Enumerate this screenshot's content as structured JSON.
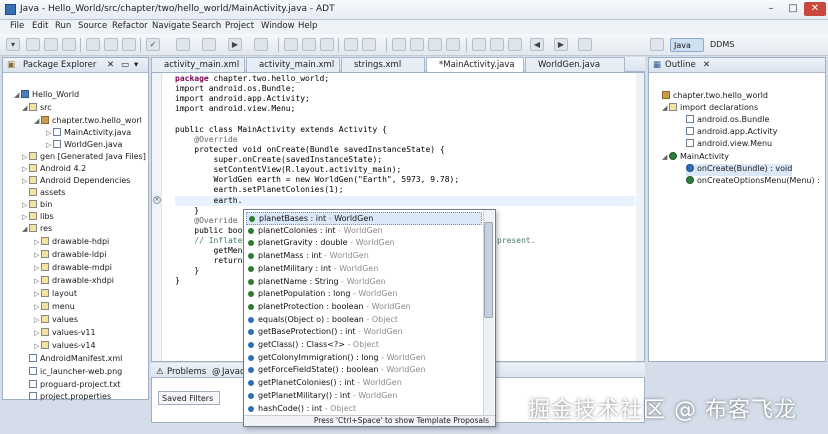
{
  "window": {
    "title": "Java - Hello_World/src/chapter/two/hello_world/MainActivity.java - ADT",
    "minimize": "–",
    "maximize": "□",
    "close": "✕"
  },
  "menu": [
    "File",
    "Edit",
    "Run",
    "Source",
    "Refactor",
    "Navigate",
    "Search",
    "Project",
    "Window",
    "Help"
  ],
  "perspectives": {
    "java": "Java",
    "ddms": "DDMS"
  },
  "package_explorer": {
    "tab": "Package Explorer",
    "items": [
      {
        "label": "Hello_World",
        "icon": "project-icon"
      },
      {
        "label": "src",
        "icon": "folder-icon"
      },
      {
        "label": "chapter.two.hello_worl",
        "icon": "package-icon"
      },
      {
        "label": "MainActivity.java",
        "icon": "java-file-icon"
      },
      {
        "label": "WorldGen.java",
        "icon": "java-file-icon"
      },
      {
        "label": "gen [Generated Java Files]",
        "icon": "folder-icon"
      },
      {
        "label": "Android 4.2",
        "icon": "library-icon"
      },
      {
        "label": "Android Dependencies",
        "icon": "library-icon"
      },
      {
        "label": "assets",
        "icon": "folder-icon"
      },
      {
        "label": "bin",
        "icon": "folder-icon"
      },
      {
        "label": "libs",
        "icon": "folder-icon"
      },
      {
        "label": "res",
        "icon": "folder-icon"
      },
      {
        "label": "drawable-hdpi",
        "icon": "folder-icon"
      },
      {
        "label": "drawable-ldpi",
        "icon": "folder-icon"
      },
      {
        "label": "drawable-mdpi",
        "icon": "folder-icon"
      },
      {
        "label": "drawable-xhdpi",
        "icon": "folder-icon"
      },
      {
        "label": "layout",
        "icon": "folder-icon"
      },
      {
        "label": "menu",
        "icon": "folder-icon"
      },
      {
        "label": "values",
        "icon": "folder-icon"
      },
      {
        "label": "values-v11",
        "icon": "folder-icon"
      },
      {
        "label": "values-v14",
        "icon": "folder-icon"
      },
      {
        "label": "AndroidManifest.xml",
        "icon": "xml-file-icon"
      },
      {
        "label": "ic_launcher-web.png",
        "icon": "image-file-icon"
      },
      {
        "label": "proguard-project.txt",
        "icon": "text-file-icon"
      },
      {
        "label": "project.properties",
        "icon": "text-file-icon"
      }
    ]
  },
  "editor": {
    "tabs": [
      "activity_main.xml",
      "activity_main.xml",
      "strings.xml",
      "*MainActivity.java",
      "WorldGen.java"
    ],
    "code": [
      "package chapter.two.hello_world;",
      "import android.os.Bundle;",
      "import android.app.Activity;",
      "import android.view.Menu;",
      "",
      "public class MainActivity extends Activity {",
      "    @Override",
      "    protected void onCreate(Bundle savedInstanceState) {",
      "        super.onCreate(savedInstanceState);",
      "        setContentView(R.layout.activity_main);",
      "        WorldGen earth = new WorldGen(\"Earth\", 5973, 9.78);",
      "        earth.setPlanetColonies(1);",
      "        earth.",
      "    }",
      "    @Override",
      "    public boo",
      "    // Inflate",
      "        getMen",
      "        return",
      "    }",
      "}"
    ],
    "tail_text": "present."
  },
  "outline": {
    "tab": "Outline",
    "items": [
      "chapter.two.hello_world",
      "import declarations",
      "android.os.Bundle",
      "android.app.Activity",
      "android.view.Menu",
      "MainActivity",
      "onCreate(Bundle) : void",
      "onCreateOptionsMenu(Menu) :"
    ]
  },
  "bottom_panel": {
    "tabs": [
      "Problems",
      "Javad"
    ],
    "saved_filters": "Saved Filters"
  },
  "content_assist": {
    "items": [
      {
        "name": "planetBases : int",
        "type": "WorldGen",
        "kind": "field"
      },
      {
        "name": "planetColonies : int",
        "type": "WorldGen",
        "kind": "field"
      },
      {
        "name": "planetGravity : double",
        "type": "WorldGen",
        "kind": "field"
      },
      {
        "name": "planetMass : int",
        "type": "WorldGen",
        "kind": "field"
      },
      {
        "name": "planetMilitary : int",
        "type": "WorldGen",
        "kind": "field"
      },
      {
        "name": "planetName : String",
        "type": "WorldGen",
        "kind": "field"
      },
      {
        "name": "planetPopulation : long",
        "type": "WorldGen",
        "kind": "field"
      },
      {
        "name": "planetProtection : boolean",
        "type": "WorldGen",
        "kind": "field"
      },
      {
        "name": "equals(Object o) : boolean",
        "type": "Object",
        "kind": "method"
      },
      {
        "name": "getBaseProtection() : int",
        "type": "WorldGen",
        "kind": "method"
      },
      {
        "name": "getClass() : Class<?>",
        "type": "Object",
        "kind": "method"
      },
      {
        "name": "getColonyImmigration() : long",
        "type": "WorldGen",
        "kind": "method"
      },
      {
        "name": "getForceFieldState() : boolean",
        "type": "WorldGen",
        "kind": "method"
      },
      {
        "name": "getPlanetColonies() : int",
        "type": "WorldGen",
        "kind": "method"
      },
      {
        "name": "getPlanetMilitary() : int",
        "type": "WorldGen",
        "kind": "method"
      },
      {
        "name": "hashCode() : int",
        "type": "Object",
        "kind": "method"
      }
    ],
    "separator": " - ",
    "footer": "Press 'Ctrl+Space' to show Template Proposals"
  },
  "watermark": "掘金技术社区 @ 布客飞龙",
  "colors": {
    "keyword": "#7f0055",
    "annotation": "#646464",
    "field_italic": "#0000c0",
    "string": "#2a00ff",
    "comment": "#3f7f5f",
    "selection": "#dbe8f8"
  }
}
